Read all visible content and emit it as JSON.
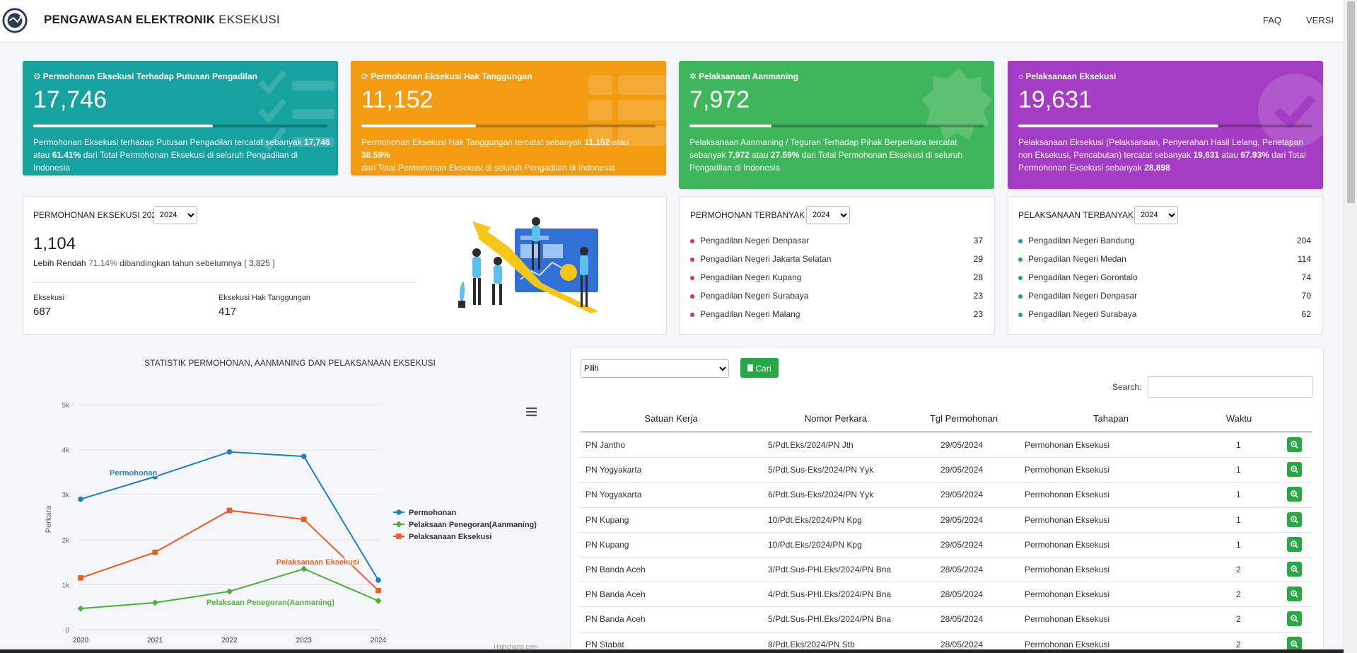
{
  "header": {
    "brand_bold": "PENGAWASAN ELEKTRONIK",
    "brand_light": "EKSEKUSI",
    "nav": [
      "FAQ",
      "VERSI"
    ]
  },
  "stats": [
    {
      "title": "Permohonan Eksekusi Terhadap Putusan Pengadilan",
      "value": "17,746",
      "progress": 0.61,
      "desc_1": "Permohonan Eksekusi terhadap Putusan Pengadilan tercatat sebanyak ",
      "desc_b1": "17,746",
      "desc_2": "atau ",
      "desc_b2": "61.41%",
      "desc_3": " dari Total Permohonan Eksekusi di seluruh Pengadilan di Indonesia",
      "color": "#17a2a0",
      "icon": "gear-icon"
    },
    {
      "title": "Permohonan Eksekusi Hak Tanggungan",
      "value": "11,152",
      "progress": 0.39,
      "desc_1": "Permohonan Eksekusi Hak Tanggungan tercatat sebanyak ",
      "desc_b1": "11,152",
      "desc_2": " atau ",
      "desc_b2": "38.59%",
      "desc_3": "dari Total Permohonan Eksekusi di seluruh Pengadilan di Indonesia",
      "color": "#f39c12",
      "icon": "refresh-icon"
    },
    {
      "title": "Pelaksanaan Aanmaning",
      "value": "7,972",
      "progress": 0.28,
      "desc_1": "Pelaksanaan Aanmaning / Teguran Terhadap Pihak Berperkara tercatat sebanyak ",
      "desc_b1": "7,972",
      "desc_2": " atau ",
      "desc_b2": "27.59%",
      "desc_3": " dari Total Permohonan Eksekusi di seluruh Pengadilan di Indonesia",
      "color": "#3fb65b",
      "icon": "spinner-icon"
    },
    {
      "title": "Pelaksanaan Eksekusi",
      "value": "19,631",
      "progress": 0.68,
      "desc_1": "Pelaksanaan Eksekusi (Pelaksanaan, Penyerahan Hasil Lelang, Penetapan non Eksekusi, Pencabutan) tercatat sebanyak ",
      "desc_b1": "19,631",
      "desc_2": " atau ",
      "desc_b2": "67.93%",
      "desc_3": " dari Total Permohonan Eksekusi sebanyak ",
      "desc_b3": "28,898",
      "color": "#a43cc4",
      "icon": "circle-icon"
    }
  ],
  "permohonan_panel": {
    "title": "PERMOHONAN EKSEKUSI 2024",
    "year": "2024",
    "total": "1,104",
    "compare_label": "Lebih Rendah",
    "compare_pct": "71.14%",
    "compare_text": "dibandingkan tahun sebelumnya [ 3,825 ]",
    "eksekusi_label": "Eksekusi",
    "eksekusi_value": "687",
    "ht_label": "Eksekusi Hak Tanggungan",
    "ht_value": "417"
  },
  "terbanyak": {
    "title": "PERMOHONAN TERBANYAK",
    "year": "2024",
    "dot_color": "#dc3545",
    "items": [
      {
        "name": "Pengadilan Negeri Denpasar",
        "count": "37"
      },
      {
        "name": "Pengadilan Negeri Jakarta Selatan",
        "count": "29"
      },
      {
        "name": "Pengadilan Negeri Kupang",
        "count": "28"
      },
      {
        "name": "Pengadilan Negeri Surabaya",
        "count": "23"
      },
      {
        "name": "Pengadilan Negeri Malang",
        "count": "23"
      }
    ]
  },
  "pelaksanaan": {
    "title": "PELAKSANAAN TERBANYAK",
    "year": "2024",
    "dot_color": "#17a2a0",
    "items": [
      {
        "name": "Pengadilan Negeri Bandung",
        "count": "204"
      },
      {
        "name": "Pengadilan Negeri Medan",
        "count": "114"
      },
      {
        "name": "Pengadilan Negeri Gorontalo",
        "count": "74"
      },
      {
        "name": "Pengadilan Negeri Denpasar",
        "count": "70"
      },
      {
        "name": "Pengadilan Negeri Surabaya",
        "count": "62"
      }
    ]
  },
  "chart_data": {
    "type": "line",
    "title": "STATISTIK PERMOHONAN, AANMANING DAN PELAKSANAAN EKSEKUSI",
    "ylabel": "Perkara",
    "xlabel": "",
    "x": [
      "2020",
      "2021",
      "2022",
      "2023",
      "2024"
    ],
    "ylim": [
      0,
      5000
    ],
    "yticks": [
      "0",
      "1k",
      "2k",
      "3k",
      "4k",
      "5k"
    ],
    "grid": true,
    "legend_position": "right",
    "series": [
      {
        "name": "Permohonan",
        "color": "#1f7fc1",
        "marker": "circle",
        "values": [
          2900,
          3400,
          3950,
          3850,
          1100
        ]
      },
      {
        "name": "Pelaksaan Penegoran(Aanmaning)",
        "color": "#4caf3c",
        "marker": "diamond",
        "values": [
          470,
          600,
          850,
          1350,
          640
        ]
      },
      {
        "name": "Pelaksanaan Eksekusi",
        "color": "#ef5b25",
        "marker": "square",
        "values": [
          1150,
          1720,
          2650,
          2450,
          870
        ]
      }
    ],
    "credit": "Highcharts.com"
  },
  "table": {
    "filter_placeholder": "Pilih",
    "search_button": "Cari",
    "search_label": "Search:",
    "headers": [
      "Satuan Kerja",
      "Nomor Perkara",
      "Tgl Permohonan",
      "Tahapan",
      "Waktu"
    ],
    "rows": [
      {
        "satker": "PN Jantho",
        "nomor": "5/Pdt.Eks/2024/PN Jth",
        "tgl": "29/05/2024",
        "tahapan": "Permohonan Eksekusi",
        "waktu": "1"
      },
      {
        "satker": "PN Yogyakarta",
        "nomor": "5/Pdt.Sus-Eks/2024/PN Yyk",
        "tgl": "29/05/2024",
        "tahapan": "Permohonan Eksekusi",
        "waktu": "1"
      },
      {
        "satker": "PN Yogyakarta",
        "nomor": "6/Pdt.Sus-Eks/2024/PN Yyk",
        "tgl": "29/05/2024",
        "tahapan": "Permohonan Eksekusi",
        "waktu": "1"
      },
      {
        "satker": "PN Kupang",
        "nomor": "10/Pdt.Eks/2024/PN Kpg",
        "tgl": "29/05/2024",
        "tahapan": "Permohonan Eksekusi",
        "waktu": "1"
      },
      {
        "satker": "PN Kupang",
        "nomor": "10/Pdt.Eks/2024/PN Kpg",
        "tgl": "29/05/2024",
        "tahapan": "Permohonan Eksekusi",
        "waktu": "1"
      },
      {
        "satker": "PN Banda Aceh",
        "nomor": "3/Pdt.Sus-PHI.Eks/2024/PN Bna",
        "tgl": "28/05/2024",
        "tahapan": "Permohonan Eksekusi",
        "waktu": "2"
      },
      {
        "satker": "PN Banda Aceh",
        "nomor": "4/Pdt.Sus-PHI.Eks/2024/PN Bna",
        "tgl": "28/05/2024",
        "tahapan": "Permohonan Eksekusi",
        "waktu": "2"
      },
      {
        "satker": "PN Banda Aceh",
        "nomor": "5/Pdt.Sus-PHI.Eks/2024/PN Bna",
        "tgl": "28/05/2024",
        "tahapan": "Permohonan Eksekusi",
        "waktu": "2"
      },
      {
        "satker": "PN Stabat",
        "nomor": "8/Pdt.Eks/2024/PN Stb",
        "tgl": "28/05/2024",
        "tahapan": "Permohonan Eksekusi",
        "waktu": "2"
      }
    ]
  }
}
